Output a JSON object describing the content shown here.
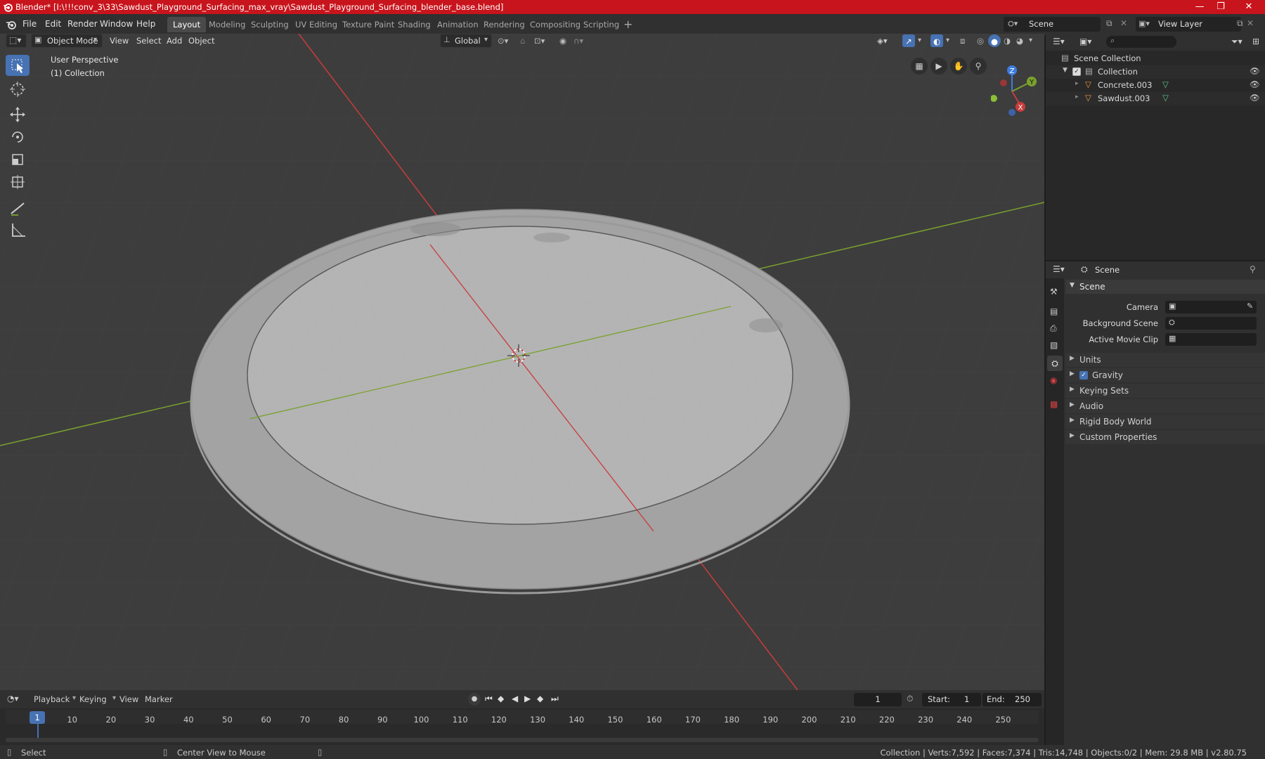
{
  "window": {
    "title": "Blender* [I:\\!!!conv_3\\33\\Sawdust_Playground_Surfacing_max_vray\\Sawdust_Playground_Surfacing_blender_base.blend]",
    "controls": [
      "—",
      "❐",
      "✕"
    ]
  },
  "menu": [
    "File",
    "Edit",
    "Render",
    "Window",
    "Help"
  ],
  "workspaces": [
    {
      "label": "Layout",
      "active": true
    },
    {
      "label": "Modeling"
    },
    {
      "label": "Sculpting"
    },
    {
      "label": "UV Editing"
    },
    {
      "label": "Texture Paint"
    },
    {
      "label": "Shading"
    },
    {
      "label": "Animation"
    },
    {
      "label": "Rendering"
    },
    {
      "label": "Compositing"
    },
    {
      "label": "Scripting"
    }
  ],
  "add_workspace": "+",
  "scene_selector": {
    "value": "Scene"
  },
  "view_layer_selector": {
    "value": "View Layer"
  },
  "viewport": {
    "mode": "Object Mode",
    "menus": [
      "View",
      "Select",
      "Add",
      "Object"
    ],
    "orientation": "Global",
    "overlay_text": {
      "perspective": "User Perspective",
      "collection": "(1) Collection"
    },
    "gizmo": {
      "x": "X",
      "y": "Y",
      "z": "Z"
    }
  },
  "outliner": {
    "root": "Scene Collection",
    "collection": "Collection",
    "objects": [
      "Concrete.003",
      "Sawdust.003"
    ]
  },
  "properties": {
    "context": "Scene",
    "panel": "Scene",
    "fields": {
      "camera": "Camera",
      "background_scene": "Background Scene",
      "active_movie_clip": "Active Movie Clip"
    },
    "sections": [
      {
        "label": "Units"
      },
      {
        "label": "Gravity",
        "checkbox": true
      },
      {
        "label": "Keying Sets"
      },
      {
        "label": "Audio"
      },
      {
        "label": "Rigid Body World"
      },
      {
        "label": "Custom Properties"
      }
    ]
  },
  "timeline": {
    "menus": [
      "Playback",
      "Keying",
      "View",
      "Marker"
    ],
    "current_frame": "1",
    "start_label": "Start:",
    "start": "1",
    "end_label": "End:",
    "end": "250",
    "frame_numbers": [
      "1",
      "10",
      "20",
      "30",
      "40",
      "50",
      "60",
      "70",
      "80",
      "90",
      "100",
      "110",
      "120",
      "130",
      "140",
      "150",
      "160",
      "170",
      "180",
      "190",
      "200",
      "210",
      "220",
      "230",
      "240",
      "250"
    ]
  },
  "status": {
    "left": "Select",
    "middle": "Center View to Mouse",
    "right": "Collection | Verts:7,592 | Faces:7,374 | Tris:14,748 | Objects:0/2 | Mem: 29.8 MB | v2.80.75"
  },
  "colors": {
    "accent": "#4772b3",
    "titlebar": "#c8141c",
    "x_axis": "#c83c3c",
    "y_axis": "#7ba12d",
    "z_axis": "#3d7de0"
  }
}
